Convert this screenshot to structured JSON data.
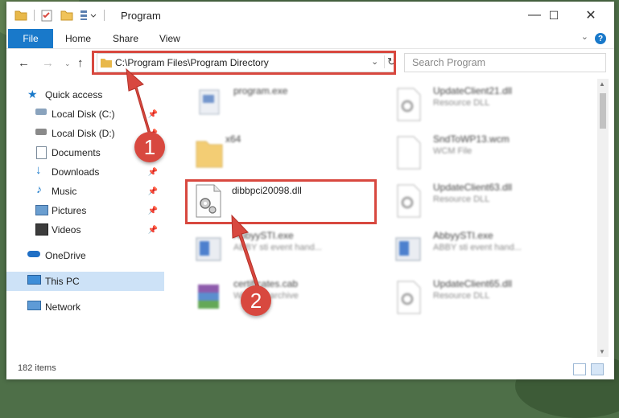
{
  "window": {
    "title": "Program",
    "controls": {
      "minimize": "—",
      "maximize": "☐",
      "close": "✕"
    }
  },
  "ribbon": {
    "tabs": [
      "File",
      "Home",
      "Share",
      "View"
    ],
    "help_label": "?"
  },
  "address_bar": {
    "path": "C:\\Program Files\\Program Directory"
  },
  "search": {
    "placeholder": "Search Program"
  },
  "nav_pane": {
    "items": [
      {
        "label": "Quick access",
        "icon": "star-icon"
      },
      {
        "label": "Local Disk (C:)",
        "icon": "drive-icon",
        "pinned": true
      },
      {
        "label": "Local Disk (D:)",
        "icon": "drive-icon",
        "pinned": true
      },
      {
        "label": "Documents",
        "icon": "documents-icon",
        "pinned": true
      },
      {
        "label": "Downloads",
        "icon": "download-icon",
        "pinned": true
      },
      {
        "label": "Music",
        "icon": "music-icon",
        "pinned": true
      },
      {
        "label": "Pictures",
        "icon": "pictures-icon",
        "pinned": true
      },
      {
        "label": "Videos",
        "icon": "videos-icon",
        "pinned": true
      },
      {
        "label": "OneDrive",
        "icon": "cloud-icon"
      },
      {
        "label": "This PC",
        "icon": "computer-icon",
        "selected": true
      },
      {
        "label": "Network",
        "icon": "network-icon"
      }
    ]
  },
  "files": [
    {
      "name": "program.exe",
      "type": "",
      "icon": "exe-icon"
    },
    {
      "name": "UpdateClient21.dll",
      "type": "Resource DLL",
      "icon": "dll-icon"
    },
    {
      "name": "x64",
      "type": "",
      "icon": "folder-icon"
    },
    {
      "name": "SndToWP13.wcm",
      "type": "WCM File",
      "icon": "file-icon"
    },
    {
      "name": "dibbpci20098.dll",
      "type": "",
      "icon": "dll-gear-icon"
    },
    {
      "name": "UpdateClient63.dll",
      "type": "Resource DLL",
      "icon": "dll-icon"
    },
    {
      "name": "AbbyySTI.exe",
      "type": "ABBY sti event hand...",
      "icon": "app-icon"
    },
    {
      "name": "AbbyySTI.exe",
      "type": "ABBY sti event hand...",
      "icon": "app-icon"
    },
    {
      "name": "certificates.cab",
      "type": "WinRAR archive",
      "icon": "winrar-icon"
    },
    {
      "name": "UpdateClient65.dll",
      "type": "Resource DLL",
      "icon": "dll-icon"
    }
  ],
  "status_bar": {
    "item_count": "182 items"
  },
  "callouts": [
    "1",
    "2"
  ],
  "colors": {
    "accent": "#1979ca",
    "highlight": "#d8483f",
    "selected_nav": "#cde2f7"
  }
}
